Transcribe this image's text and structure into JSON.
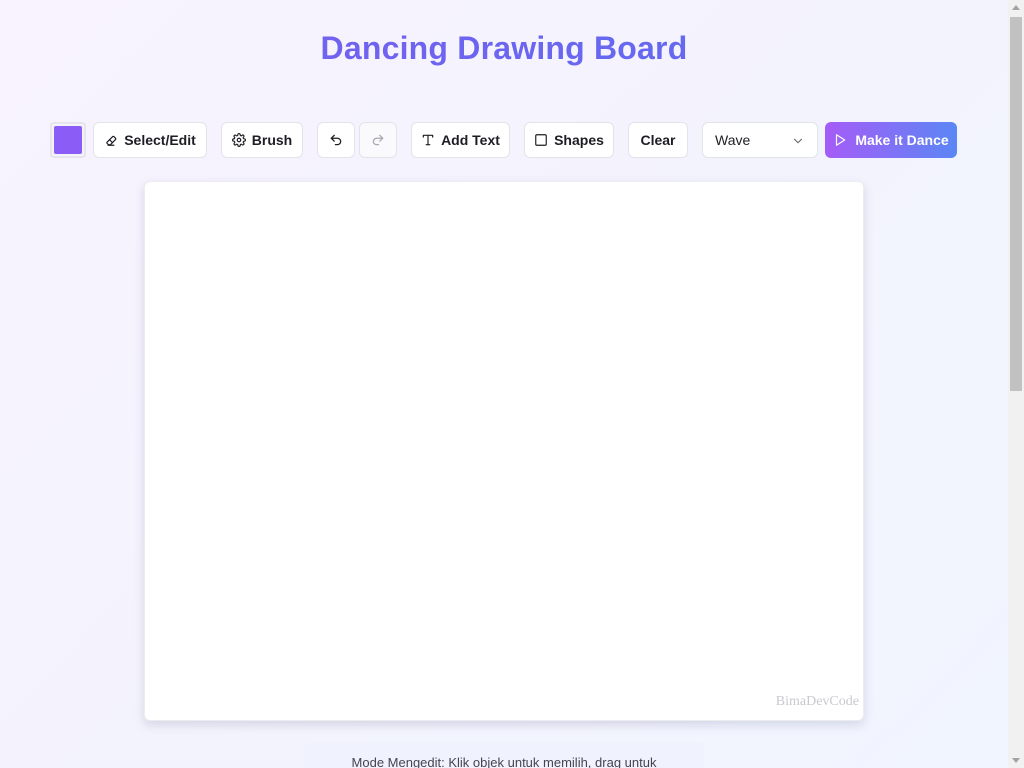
{
  "header": {
    "title": "Dancing Drawing Board"
  },
  "toolbar": {
    "color": "#8b5cf6",
    "select_edit_label": "Select/Edit",
    "select_edit_icon": "eraser-icon",
    "brush_label": "Brush",
    "brush_icon": "gear-icon",
    "undo_icon": "undo-icon",
    "redo_icon": "redo-icon",
    "add_text_label": "Add Text",
    "add_text_icon": "type-icon",
    "shapes_label": "Shapes",
    "shapes_icon": "square-icon",
    "clear_label": "Clear",
    "animation_select": {
      "selected": "Wave"
    },
    "dance_label": "Make it Dance",
    "dance_icon": "play-icon"
  },
  "canvas": {
    "watermark": "BimaDevCode"
  },
  "hint": {
    "text": "Mode Mengedit: Klik objek untuk memilih, drag untuk"
  },
  "colors": {
    "accent_gradient_start": "#a55cf6",
    "accent_gradient_end": "#5b86f5",
    "title_gradient_start": "#7c5cf0",
    "title_gradient_end": "#5b6ef0"
  }
}
